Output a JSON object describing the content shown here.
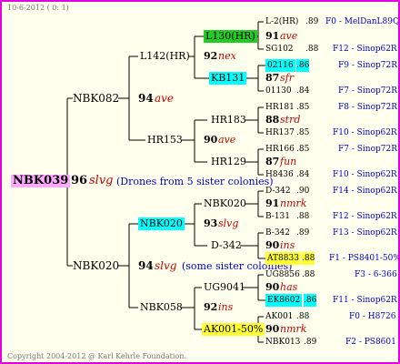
{
  "header": {
    "date": "10-6-2012 ( 0: 1)"
  },
  "footer": {
    "copyright": "Copyright 2004-2012 @ Karl Kehrle Foundation."
  },
  "colors": {
    "frame": "#e000e0",
    "background": "#ffffee",
    "root_bg": "#ffaaff",
    "green_bg": "#22cc22",
    "cyan_bg": "#00ffff",
    "yellow_bg": "#ffff33"
  },
  "root": {
    "name": "NBK039",
    "score": "96",
    "code": "slvg",
    "note": "(Drones from 5 sister colonies)"
  },
  "gen1": [
    {
      "name": "NBK082",
      "score": "94",
      "code": "ave"
    },
    {
      "name": "NBK020",
      "score": "94",
      "code": "slvg",
      "note": "(some sister colonies)"
    }
  ],
  "gen2": [
    {
      "name": "L142(HR)",
      "score": "92",
      "code": "nex"
    },
    {
      "name": "HR153",
      "score": "90",
      "code": "ave"
    },
    {
      "name": "NBK020",
      "score": "93",
      "code": "slvg"
    },
    {
      "name": "NBK058",
      "score": "92",
      "code": "ins"
    }
  ],
  "gen3": [
    {
      "name": "L130(HR)",
      "score": "91",
      "code": "ave"
    },
    {
      "name": "KB131",
      "score": "87",
      "code": "sfr"
    },
    {
      "name": "HR183",
      "score": "88",
      "code": "strd"
    },
    {
      "name": "HR129",
      "score": "87",
      "code": "fun"
    },
    {
      "name": "NBK020",
      "score": "91",
      "code": "nmrk"
    },
    {
      "name": "D-342",
      "score": "90",
      "code": "ins"
    },
    {
      "name": "UG9041",
      "score": "90",
      "code": "has"
    },
    {
      "name": "AK001-50%",
      "score": "90",
      "code": "nmrk"
    }
  ],
  "gen4": [
    {
      "name": "L-2(HR)",
      "score": ".89",
      "ref": "F0 - MelDanL89Q"
    },
    {
      "name": "SG102",
      "score": ".88",
      "ref": "F12 - Sinop62R"
    },
    {
      "name": "02116",
      "score": ".86",
      "ref": "F9 - Sinop72R"
    },
    {
      "name": "01130",
      "score": ".84",
      "ref": "F7 - Sinop72R"
    },
    {
      "name": "HR181",
      "score": ".85",
      "ref": "F8 - Sinop72R"
    },
    {
      "name": "HR137",
      "score": ".85",
      "ref": "F10 - Sinop62R"
    },
    {
      "name": "HR166",
      "score": ".85",
      "ref": "F7 - Sinop72R"
    },
    {
      "name": "H8436",
      "score": ".84",
      "ref": "F10 - Sinop62R"
    },
    {
      "name": "D-342",
      "score": ".90",
      "ref": "F14 - Sinop62R"
    },
    {
      "name": "B-131",
      "score": ".88",
      "ref": "F12 - Sinop62R"
    },
    {
      "name": "B-342",
      "score": ".89",
      "ref": "F13 - Sinop62R"
    },
    {
      "name": "AT8833",
      "score": ".88",
      "ref": "F1 - PS8401-50%"
    },
    {
      "name": "UG8856",
      "score": ".88",
      "ref": "F3 - 6-366"
    },
    {
      "name": "EK8602",
      "score": ".86",
      "ref": "F11 - Sinop62R"
    },
    {
      "name": "AK001",
      "score": ".88",
      "ref": "F0 - H8726"
    },
    {
      "name": "NBK013",
      "score": ".89",
      "ref": "F2 - PS8601"
    }
  ]
}
